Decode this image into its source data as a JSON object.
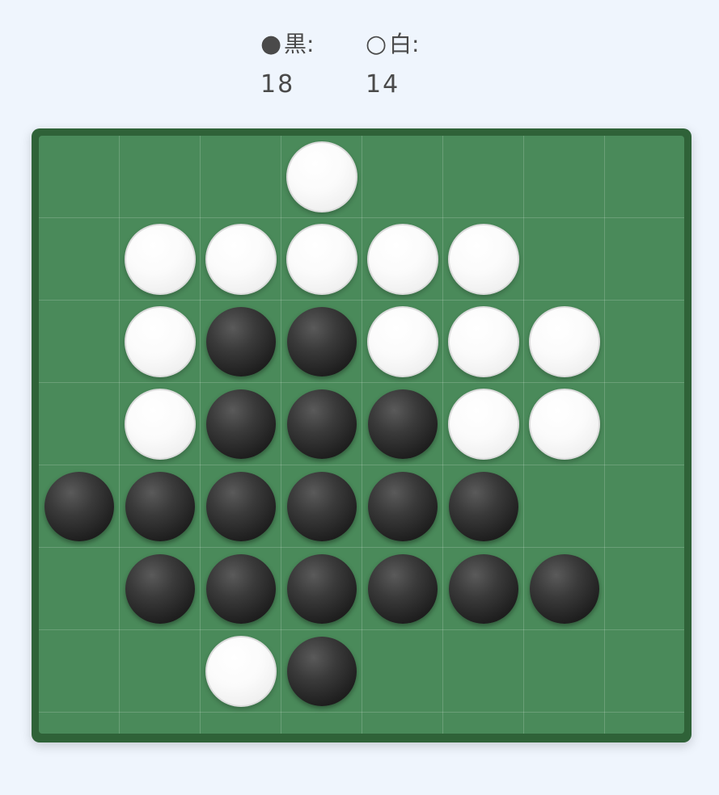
{
  "scoreboard": {
    "black": {
      "glyph": "●",
      "label": "黒:",
      "count": "18"
    },
    "white": {
      "glyph": "○",
      "label": "白:",
      "count": "14"
    }
  },
  "board": {
    "size": 8,
    "colors": {
      "board": "#4a8a5a",
      "frame": "#2f6238"
    },
    "rows": [
      [
        "",
        "",
        "",
        "W",
        "",
        "",
        "",
        ""
      ],
      [
        "",
        "W",
        "W",
        "W",
        "W",
        "W",
        "",
        ""
      ],
      [
        "",
        "W",
        "B",
        "B",
        "W",
        "W",
        "W",
        ""
      ],
      [
        "",
        "W",
        "B",
        "B",
        "B",
        "W",
        "W",
        ""
      ],
      [
        "B",
        "B",
        "B",
        "B",
        "B",
        "B",
        "",
        ""
      ],
      [
        "",
        "B",
        "B",
        "B",
        "B",
        "B",
        "B",
        ""
      ],
      [
        "",
        "",
        "W",
        "B",
        "",
        "",
        "",
        ""
      ],
      [
        "",
        "",
        "",
        "",
        "",
        "",
        "",
        ""
      ]
    ]
  }
}
